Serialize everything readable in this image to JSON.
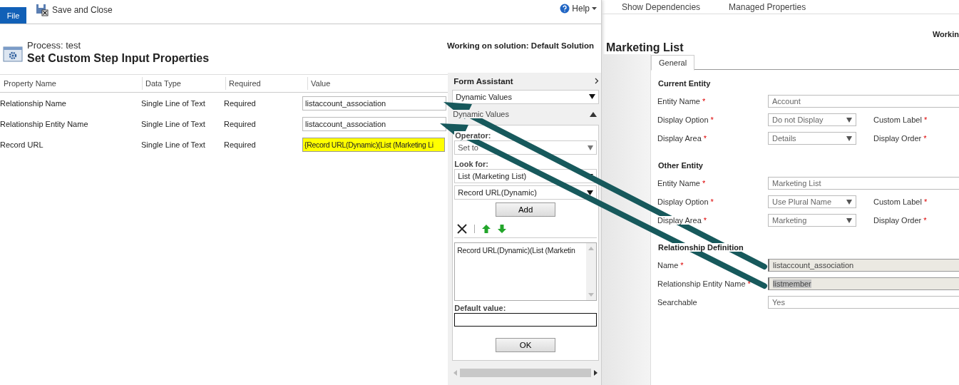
{
  "ribbon": {
    "file_tab": "File",
    "save_close": "Save and Close",
    "help": "Help"
  },
  "header": {
    "process": "Process: test",
    "title": "Set Custom Step Input Properties",
    "solution": "Working on solution: Default Solution"
  },
  "properties": {
    "columns": [
      "Property Name",
      "Data Type",
      "Required",
      "Value"
    ],
    "rows": [
      {
        "name": "Relationship Name",
        "data_type": "Single Line of Text",
        "required": "Required",
        "value": "listaccount_association",
        "highlighted": false
      },
      {
        "name": "Relationship Entity Name",
        "data_type": "Single Line of Text",
        "required": "Required",
        "value": "listaccount_association",
        "highlighted": false
      },
      {
        "name": "Record URL",
        "data_type": "Single Line of Text",
        "required": "Required",
        "value": "{Record URL(Dynamic)(List (Marketing Li",
        "highlighted": true
      }
    ]
  },
  "form_assistant": {
    "title": "Form Assistant",
    "mode": "Dynamic Values",
    "section": "Dynamic Values",
    "expanded": true,
    "operator_label": "Operator:",
    "operator": "Set to",
    "look_for_label": "Look for:",
    "look_for": "List (Marketing List)",
    "field": "Record URL(Dynamic)",
    "add": "Add",
    "values": [
      "Record URL(Dynamic)(List (Marketin"
    ],
    "default_label": "Default value:",
    "ok": "OK"
  },
  "entity_window": {
    "toolbar": [
      "Show Dependencies",
      "Managed Properties"
    ],
    "solution": "Workin",
    "title": "Marketing List",
    "tabs": [
      {
        "label": "General",
        "selected": true
      }
    ],
    "sections": [
      {
        "title_parts": [
          "Current Entity"
        ],
        "fields": [
          {
            "label_parts": [
              "Entity Name"
            ],
            "required": "*",
            "kind": "text",
            "value": "Account"
          },
          {
            "label_parts": [
              "Display Option"
            ],
            "required": "*",
            "kind": "select",
            "value": "Do not Display",
            "side": {
              "label": "Custom Label",
              "required": "*"
            }
          },
          {
            "label_parts": [
              "Display Area"
            ],
            "required": "*",
            "kind": "select",
            "value": "Details",
            "side": {
              "label": "Display Order",
              "required": "*"
            }
          }
        ]
      },
      {
        "title_parts": [
          "Other Entity"
        ],
        "fields": [
          {
            "label_parts": [
              "Entity Name"
            ],
            "required": "*",
            "kind": "text",
            "value": "Marketing List"
          },
          {
            "label_parts": [
              "Display Option"
            ],
            "required": "*",
            "kind": "select",
            "value": "Use Plural Name",
            "side": {
              "label": "Custom Label",
              "required": "*"
            }
          },
          {
            "label_parts": [
              "Display Area"
            ],
            "required": "*",
            "kind": "select",
            "value": "Marketing",
            "side": {
              "label": "Display Order",
              "required": "*"
            }
          }
        ]
      },
      {
        "title_parts": [
          "Relationship Definition"
        ],
        "fields": [
          {
            "label_parts": [
              "Name"
            ],
            "required": "*",
            "kind": "readonly",
            "value": "listaccount_association",
            "highlighted": false
          },
          {
            "label_parts": [
              "Relationship Entity Name"
            ],
            "required": "*",
            "kind": "readonly",
            "value": "listmember",
            "highlighted": true
          },
          {
            "label_parts": [
              "Searchable"
            ],
            "kind": "text",
            "value": "Yes"
          }
        ]
      }
    ]
  }
}
